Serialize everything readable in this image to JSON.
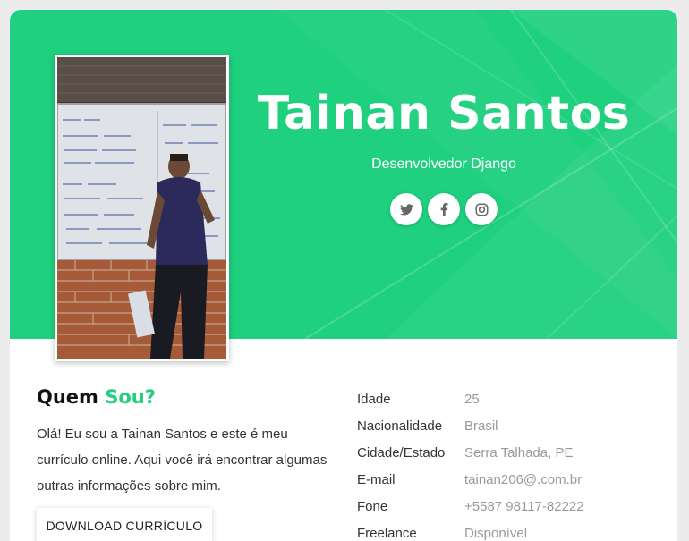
{
  "profile": {
    "name": "Tainan Santos",
    "role": "Desenvolvedor Django"
  },
  "socials": [
    {
      "icon": "twitter-icon"
    },
    {
      "icon": "facebook-icon"
    },
    {
      "icon": "instagram-icon"
    }
  ],
  "about": {
    "title_part1": "Quem ",
    "title_part2": "Sou?",
    "text": "Olá! Eu sou a Tainan Santos e este é meu currículo online. Aqui você irá encontrar algumas outras informações sobre mim.",
    "download_label": "DOWNLOAD CURRÍCULO"
  },
  "info": [
    {
      "label": "Idade",
      "value": "25"
    },
    {
      "label": "Nacionalidade",
      "value": "Brasil"
    },
    {
      "label": "Cidade/Estado",
      "value": "Serra Talhada, PE"
    },
    {
      "label": "E-mail",
      "value": "tainan206@.com.br"
    },
    {
      "label": "Fone",
      "value": "+5587 98117-82222"
    },
    {
      "label": "Freelance",
      "value": "Disponível"
    }
  ],
  "colors": {
    "accent": "#1fd07f",
    "background": "#ececec"
  }
}
